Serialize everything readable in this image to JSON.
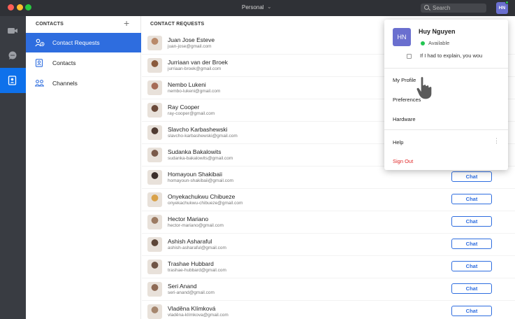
{
  "window": {
    "title": "Personal"
  },
  "search": {
    "placeholder": "Search"
  },
  "user": {
    "initials": "HN",
    "name": "Huy Nguyen",
    "status": "Available",
    "status_note": "If I had to explain, you wou"
  },
  "sidebar": {
    "header": "CONTACTS",
    "items": [
      {
        "label": "Contact Requests",
        "icon": "contact-requests-icon"
      },
      {
        "label": "Contacts",
        "icon": "contacts-book-icon"
      },
      {
        "label": "Channels",
        "icon": "channels-icon"
      }
    ]
  },
  "main": {
    "header": "CONTACT REQUESTS",
    "chat_label": "Chat",
    "contacts": [
      {
        "name": "Juan Jose Esteve",
        "email": "juan-jose@gmail.com"
      },
      {
        "name": "Jurriaan van der Broek",
        "email": "jurriaan-broek@gmail.com"
      },
      {
        "name": "Nembo Lukeni",
        "email": "nembo-lukeni@gmail.com"
      },
      {
        "name": "Ray Cooper",
        "email": "ray-cooper@gmail.com"
      },
      {
        "name": "Slavcho Karbashewski",
        "email": "slavcho-karbashewski@gmail.com"
      },
      {
        "name": "Sudanka Bakalowits",
        "email": "sudanka-bakalowits@gmail.com"
      },
      {
        "name": "Homayoun Shakibaii",
        "email": "homayoun-shakibaii@gmail.com"
      },
      {
        "name": "Onyekachukwu Chibueze",
        "email": "onyekachukwu-chibueze@gmail.com"
      },
      {
        "name": "Hector Mariano",
        "email": "hector-mariano@gmail.com"
      },
      {
        "name": "Ashish Asharaful",
        "email": "ashish-asharaful@gmail.com"
      },
      {
        "name": "Trashae Hubbard",
        "email": "trashae-hubbard@gmail.com"
      },
      {
        "name": "Seri Anand",
        "email": "seri-anand@gmail.com"
      },
      {
        "name": "Vladěna Klímková",
        "email": "vladěna-klímkova@gmail.com"
      }
    ]
  },
  "dropdown": {
    "items": [
      {
        "label": "My Profile"
      },
      {
        "label": "Preferences"
      },
      {
        "label": "Hardware"
      },
      {
        "label": "Help"
      },
      {
        "label": "Sign Out"
      }
    ]
  },
  "colors": {
    "accent": "#2e6ddf",
    "available": "#23c552",
    "danger": "#e02828",
    "rail": "#393c42"
  }
}
